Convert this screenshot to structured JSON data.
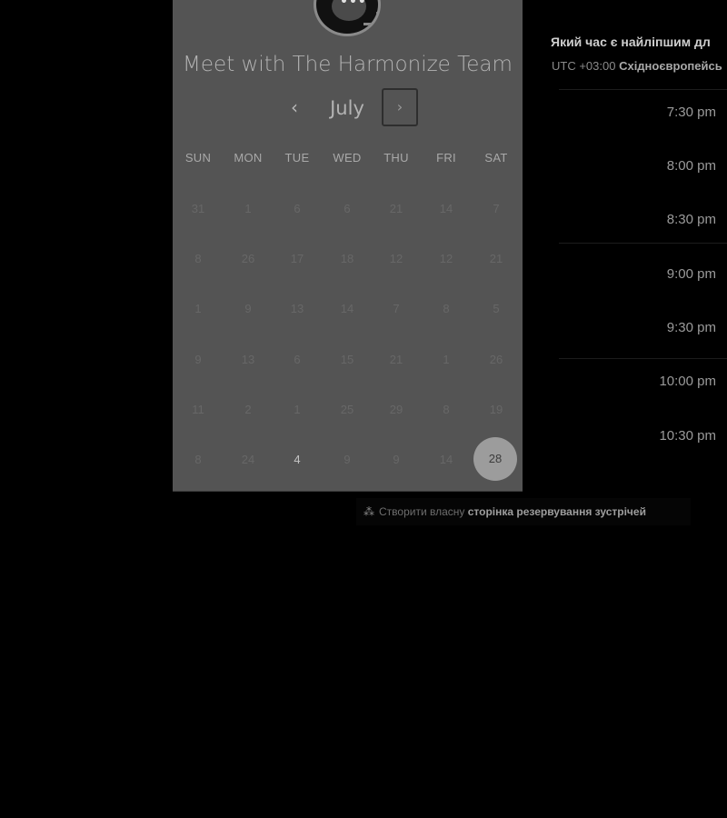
{
  "booking": {
    "title": "Meet with The Harmonize Team",
    "nav": {
      "prev_icon": "‹",
      "next_icon": "›",
      "month": "July"
    },
    "weekdays": [
      "SUN",
      "MON",
      "TUE",
      "WED",
      "THU",
      "FRI",
      "SAT"
    ],
    "weeks": [
      [
        "31",
        "1",
        "6",
        "6",
        "21",
        "14",
        "7"
      ],
      [
        "8",
        "26",
        "17",
        "18",
        "12",
        "12",
        "21"
      ],
      [
        "1",
        "9",
        "13",
        "14",
        "7",
        "8",
        "5"
      ],
      [
        "9",
        "13",
        "6",
        "15",
        "21",
        "1",
        "26"
      ],
      [
        "11",
        "2",
        "1",
        "25",
        "29",
        "8",
        "19"
      ],
      [
        "8",
        "24",
        "4",
        "9",
        "9",
        "14",
        "28"
      ]
    ],
    "active_day": "4",
    "selected_day": "28"
  },
  "times": {
    "question": "Який час є найліпшим дл",
    "tz_prefix": "UTC +03:00",
    "tz_name": "Східноєвропейсь",
    "slots": [
      "7:30 pm",
      "8:00 pm",
      "8:30 pm",
      "9:00 pm",
      "9:30 pm",
      "10:00 pm",
      "10:30 pm"
    ]
  },
  "footer": {
    "icon": "hubspot-sprocket-icon",
    "text": "Створити власну",
    "link": "сторінка резервування зустрічей"
  }
}
